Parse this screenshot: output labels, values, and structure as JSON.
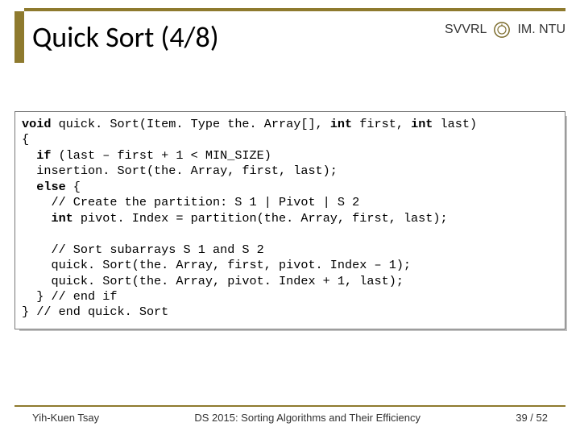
{
  "header": {
    "title": "Quick Sort (4/8)",
    "org_left": "SVVRL",
    "at": "@",
    "org_right": "IM. NTU"
  },
  "code": {
    "l1a": "void",
    "l1b": " quick. Sort(Item. Type the. Array[], ",
    "l1c": "int",
    "l1d": " first, ",
    "l1e": "int",
    "l1f": " last)",
    "l2": "{",
    "l3a": "  if",
    "l3b": " (last – first + 1 < MIN_SIZE)",
    "l4": "  insertion. Sort(the. Array, first, last);",
    "l5a": "  else",
    "l5b": " {",
    "l6": "    // Create the partition: S 1 | Pivot | S 2",
    "l7a": "    int",
    "l7b": " pivot. Index = partition(the. Array, first, last);",
    "blank": "",
    "l8": "    // Sort subarrays S 1 and S 2",
    "l9": "    quick. Sort(the. Array, first, pivot. Index – 1);",
    "l10": "    quick. Sort(the. Array, pivot. Index + 1, last);",
    "l11": "  } // end if",
    "l12": "} // end quick. Sort"
  },
  "footer": {
    "left": "Yih-Kuen Tsay",
    "center": "DS 2015: Sorting Algorithms and Their Efficiency",
    "right": "39 / 52"
  }
}
